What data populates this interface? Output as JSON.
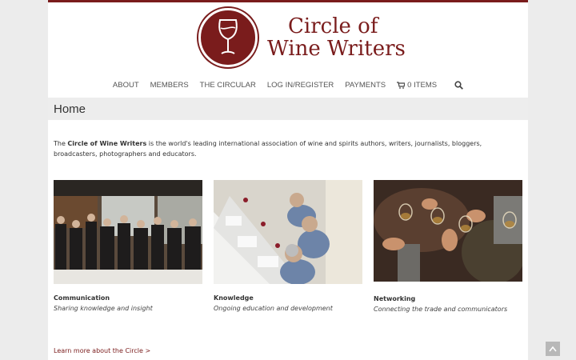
{
  "logo": {
    "line1": "Circle of",
    "line2": "Wine Writers"
  },
  "nav": {
    "items": [
      "ABOUT",
      "MEMBERS",
      "THE CIRCULAR",
      "LOG IN/REGISTER",
      "PAYMENTS"
    ],
    "cart_label": "0 ITEMS"
  },
  "page_title": "Home",
  "intro": {
    "before": "The ",
    "bold": "Circle of Wine Writers",
    "after": " is the world's leading international association of wine and spirits authors, writers, journalists, bloggers, broadcasters, photographers and educators."
  },
  "cards": [
    {
      "title": "Communication",
      "subtitle": "Sharing knowledge and insight"
    },
    {
      "title": "Knowledge",
      "subtitle": "Ongoing education and development"
    },
    {
      "title": "Networking",
      "subtitle": "Connecting the trade and communicators"
    }
  ],
  "learn_more": "Learn more about the Circle >",
  "colors": {
    "brand": "#7a1c1c",
    "bar": "#ededed"
  },
  "icons": [
    "wine-glass-logo-icon",
    "cart-icon",
    "search-icon",
    "arrow-up-icon"
  ]
}
